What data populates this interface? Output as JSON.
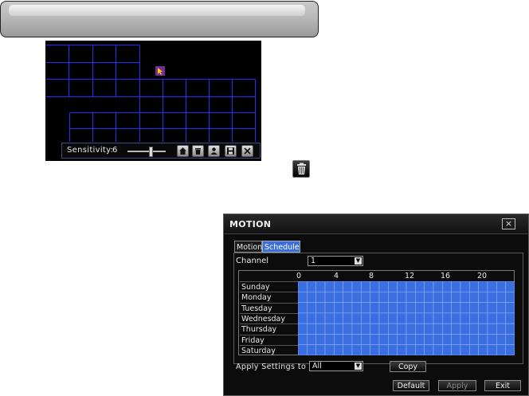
{
  "preview": {
    "sensitivity_label": "Sensitivity:",
    "sensitivity_value": "6",
    "tools": [
      "home-icon",
      "trash-icon",
      "person-icon",
      "save-icon",
      "close-icon"
    ]
  },
  "dialog": {
    "title": "MOTION",
    "close_label": "×",
    "tabs": {
      "motion": "Motion",
      "schedule": "Schedule"
    },
    "channel_label": "Channel",
    "channel_value": "1",
    "hours": [
      "0",
      "4",
      "8",
      "12",
      "16",
      "20"
    ],
    "days": [
      "Sunday",
      "Monday",
      "Tuesday",
      "Wednesday",
      "Thursday",
      "Friday",
      "Saturday"
    ],
    "apply_label": "Apply  Settings  to",
    "apply_value": "All",
    "copy_label": "Copy",
    "default_label": "Default",
    "apply_button_label": "Apply",
    "exit_label": "Exit"
  },
  "colors": {
    "schedule_fill": "#3b6fe0",
    "grid_line": "#2a2aff",
    "tab_active": "#3d6dd6"
  }
}
